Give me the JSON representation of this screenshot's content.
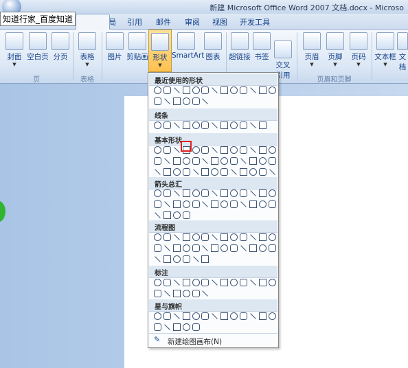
{
  "window": {
    "title": "新建 Microsoft Office Word 2007 文档.docx - Microso"
  },
  "tooltip": "知道行家_百度知道",
  "tabs": [
    "页面布局",
    "引用",
    "邮件",
    "审阅",
    "视图",
    "开发工具"
  ],
  "ribbon": {
    "buttons": {
      "cover": "封面",
      "blank_page": "空白页",
      "page_break": "分页",
      "table": "表格",
      "picture": "图片",
      "clipart": "剪贴画",
      "shapes": "形状",
      "smartart": "SmartArt",
      "chart": "图表",
      "hyperlink": "超链接",
      "bookmark": "书签",
      "cross_ref": "交叉\n引用",
      "header": "页眉",
      "footer": "页脚",
      "page_number": "页码",
      "textbox": "文本框",
      "text_more": "文档"
    },
    "groups": {
      "pages": "页",
      "tables": "表格",
      "header_footer": "页眉和页脚"
    }
  },
  "shapes_menu": {
    "sections": {
      "recent": "最近使用的形状",
      "lines": "线条",
      "basic": "基本形状",
      "arrows": "箭头总汇",
      "flowchart": "流程图",
      "callouts": "标注",
      "stars": "星与旗帜"
    },
    "new_canvas": "新建绘图画布(N)"
  }
}
